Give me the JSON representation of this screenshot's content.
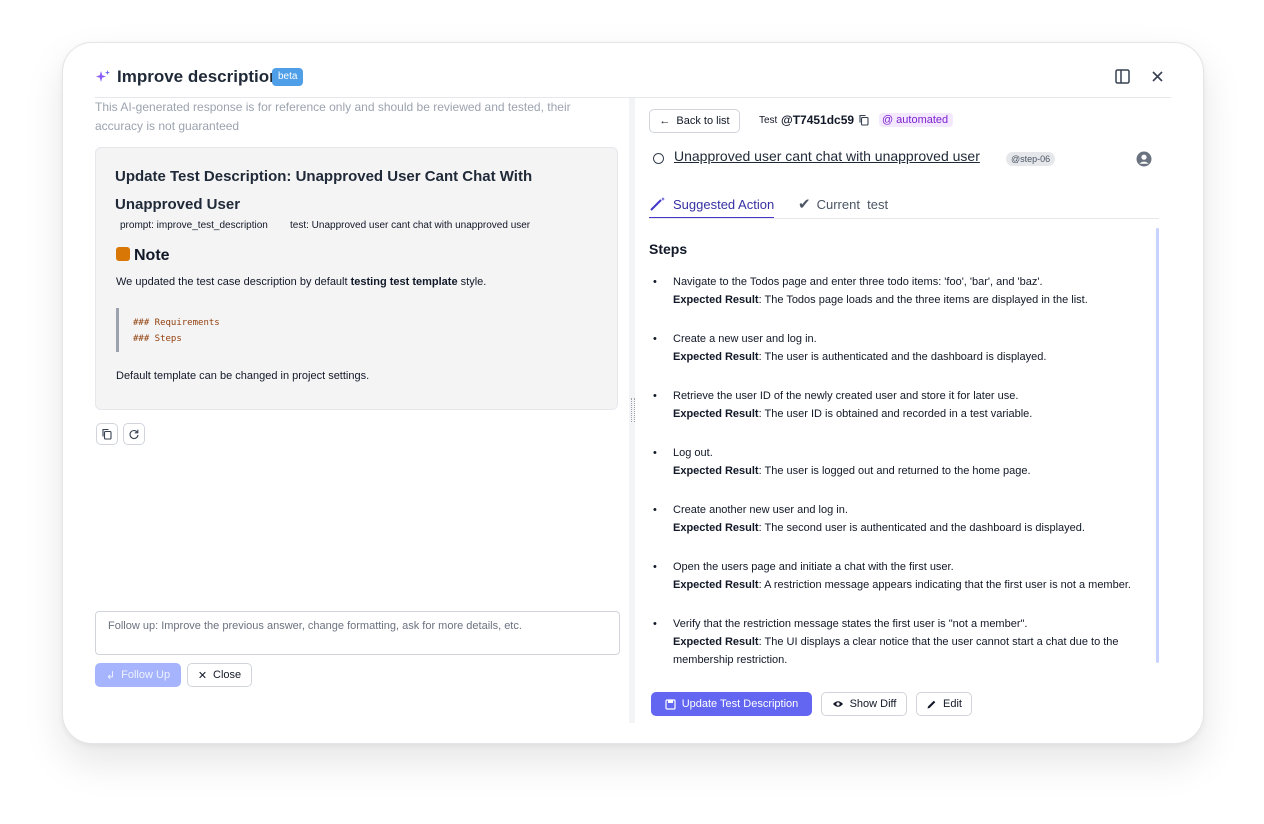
{
  "header": {
    "title": "Improve description",
    "beta": "beta"
  },
  "left": {
    "disclaimer": "This AI-generated response is for reference only and should be reviewed and tested, their accuracy is not guaranteed",
    "card_title": "Update Test Description: Unapproved User Cant Chat With Unapproved User",
    "meta_prompt": "prompt: improve_test_description",
    "meta_test": "test: Unapproved user cant chat with unapproved user",
    "note_heading": "Note",
    "note_text_pre": "We updated the test case description by default ",
    "note_text_bold": "testing test template",
    "note_text_post": " style.",
    "quote_line1": "### Requirements",
    "quote_line2": "### Steps",
    "card_footer": "Default template can be changed in project settings.",
    "followup_placeholder": "Follow up: Improve the previous answer, change formatting, ask for more details, etc.",
    "followup_btn": "Follow Up",
    "close_btn": "Close"
  },
  "right": {
    "back_btn": "Back to list",
    "test_label": "Test",
    "test_id": "@T7451dc59",
    "automated": "automated",
    "test_title": "Unapproved user cant chat with unapproved user",
    "step_badge": "@step-06",
    "tab_suggested": "Suggested Action",
    "tab_current": "Current  test",
    "steps_heading": "Steps",
    "expected_label": "Expected Result",
    "steps": [
      {
        "action": "Navigate to the Todos page and enter three todo items: 'foo', 'bar', and 'baz'.",
        "result": ": The Todos page loads and the three items are displayed in the list."
      },
      {
        "action": "Create a new user and log in.",
        "result": ": The user is authenticated and the dashboard is displayed."
      },
      {
        "action": "Retrieve the user ID of the newly created user and store it for later use.",
        "result": ": The user ID is obtained and recorded in a test variable."
      },
      {
        "action": "Log out.",
        "result": ": The user is logged out and returned to the home page."
      },
      {
        "action": "Create another new user and log in.",
        "result": ": The second user is authenticated and the dashboard is displayed."
      },
      {
        "action": "Open the users page and initiate a chat with the first user.",
        "result": ": A restriction message appears indicating that the first user is not a member."
      },
      {
        "action": "Verify that the restriction message states the first user is \"not a member\".",
        "result": ": The UI displays a clear notice that the user cannot start a chat due to the membership restriction."
      }
    ],
    "update_btn": "Update Test Description",
    "diff_btn": "Show Diff",
    "edit_btn": "Edit"
  },
  "colors": {
    "accent": "#6366f1",
    "beta": "#4f9ee8",
    "automated": "#7e22ce"
  }
}
